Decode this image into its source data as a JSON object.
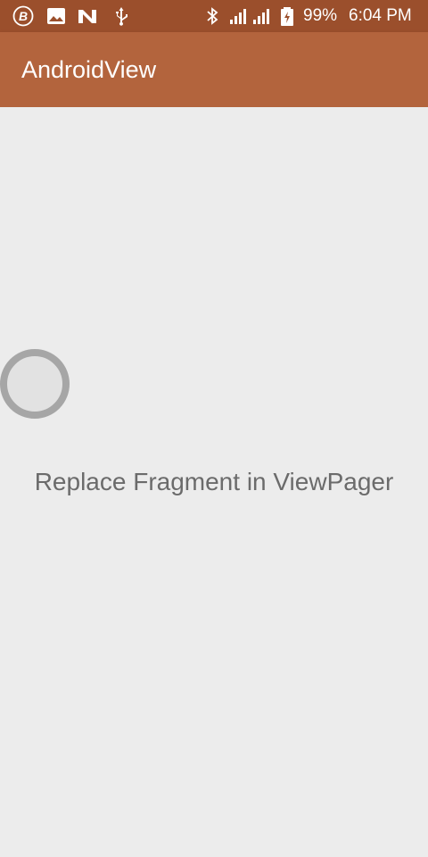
{
  "status_bar": {
    "battery_percent": "99%",
    "time": "6:04 PM",
    "background": "#9b4f2c",
    "left_icons": [
      "b-badge-icon",
      "image-icon",
      "n-logo-icon",
      "usb-icon"
    ],
    "right_icons": [
      "bluetooth-icon",
      "signal-1-icon",
      "signal-2-icon",
      "battery-icon"
    ]
  },
  "app_bar": {
    "title": "AndroidView",
    "background": "#b3643d"
  },
  "content": {
    "text": "Replace Fragment in ViewPager",
    "background": "#ececec"
  }
}
